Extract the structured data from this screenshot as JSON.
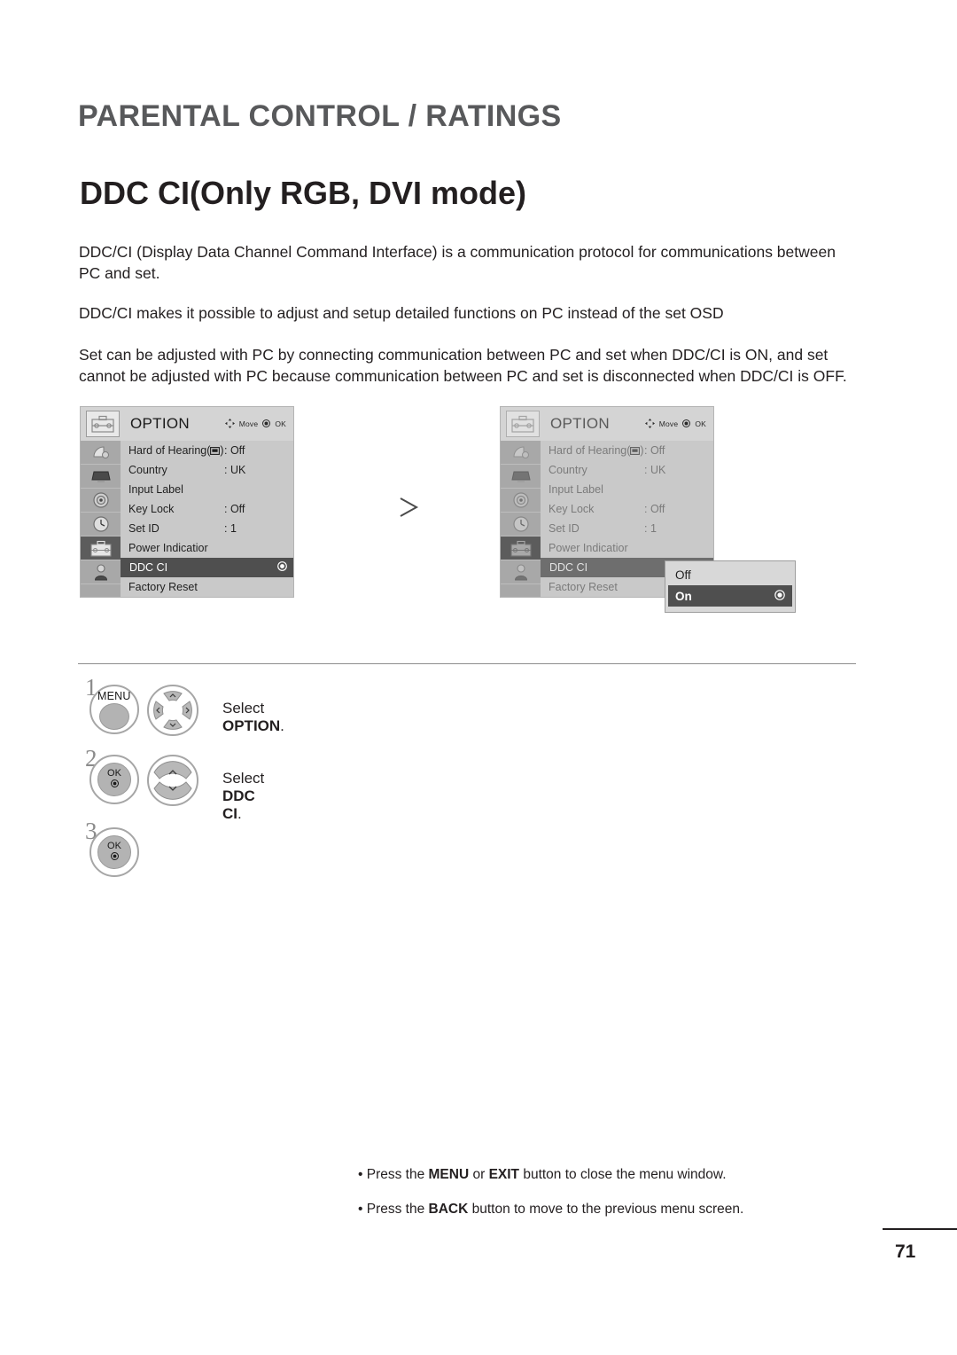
{
  "document": {
    "chapter_title": "PARENTAL CONTROL / RATINGS",
    "section_title": "DDC CI(Only RGB, DVI mode)",
    "page_number": "71"
  },
  "paragraphs": {
    "p1": "DDC/CI (Display Data Channel Command Interface) is a communication protocol for communications between PC and set.",
    "p2": "DDC/CI makes it possible to adjust and setup detailed functions on PC instead of the set OSD",
    "p3": "Set can be adjusted with PC by connecting communication between PC and set when DDC/CI is ON, and set cannot be adjusted with PC because communication between PC and set is disconnected when DDC/CI is OFF."
  },
  "osd": {
    "title": "OPTION",
    "hint_move": "Move",
    "hint_ok": "OK",
    "rail_icons": [
      "satellite-dish-icon",
      "monitor-icon",
      "sound-target-icon",
      "clock-icon",
      "toolbox-icon",
      "lock-person-icon"
    ],
    "rail_active_index": 4,
    "rows": [
      {
        "label": "Hard of Hearing(",
        "label_suffix": ")",
        "has_cc_icon": true,
        "value": ": Off"
      },
      {
        "label": "Country",
        "value": ": UK"
      },
      {
        "label": "Input Label",
        "value": ""
      },
      {
        "label": "Key Lock",
        "value": ": Off"
      },
      {
        "label": "Set ID",
        "value": ": 1"
      },
      {
        "label": "Power Indicatior",
        "value": ""
      },
      {
        "label": "DDC CI",
        "value": "",
        "selected": true
      },
      {
        "label": "Factory Reset",
        "value": ""
      }
    ]
  },
  "popup": {
    "options": [
      {
        "label": "Off",
        "selected": false
      },
      {
        "label": "On",
        "selected": true
      }
    ]
  },
  "steps": [
    {
      "number": "1",
      "button_label": "MENU",
      "text_prefix": "Select ",
      "text_bold": "OPTION",
      "text_suffix": "."
    },
    {
      "number": "2",
      "button_label": "OK",
      "text_prefix": "Select ",
      "text_bold": "DDC CI",
      "text_suffix": "."
    },
    {
      "number": "3",
      "button_label": "OK",
      "text_prefix": "",
      "text_bold": "",
      "text_suffix": ""
    }
  ],
  "notes": {
    "note1_a": "• Press the ",
    "note1_b": "MENU",
    "note1_c": " or ",
    "note1_d": "EXIT",
    "note1_e": " button to close the menu window.",
    "note2_a": "• Press the ",
    "note2_b": "BACK",
    "note2_c": " button to move to the previous menu screen."
  },
  "colors": {
    "heading_grey": "#58595b",
    "osd_bg": "#c9c9c9",
    "osd_selected": "#4f4f4f",
    "rail_bg": "#a8a8a8"
  }
}
